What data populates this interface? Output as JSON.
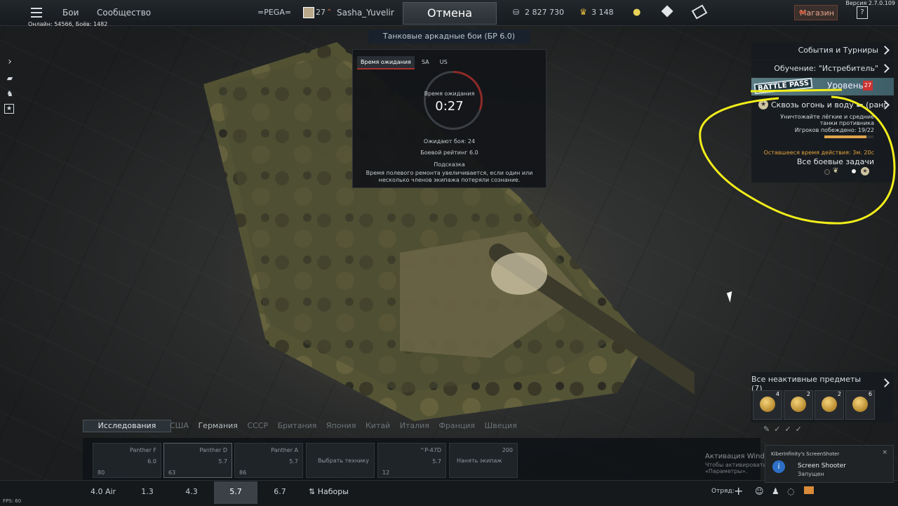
{
  "topbar": {
    "nav": [
      "Бои",
      "Сообщество"
    ],
    "squadron": "=PEGA=",
    "player_level": "27",
    "player_name": "Sasha_Yuvelir",
    "cancel_label": "Отмена",
    "silver_lions": "2 827 730",
    "golden_eagles": "3 148",
    "shop_label": "Магазин",
    "help_label": "?",
    "online_stats": "Онлайн: 54566, Боёв: 1482",
    "version": "Версия 2.7.0.109"
  },
  "game_info": "Танковые аркадные бои (БР 6.0)",
  "queue": {
    "tabs": [
      "Время ожидания",
      "SA",
      "US"
    ],
    "wait_label": "Время ожидания",
    "wait_time": "0:27",
    "waiting_battles": "Ожидают боя: 24",
    "battle_rating": "Боевой рейтинг 6.0",
    "hint_title": "Подсказка",
    "hint_text": "Время полевого ремонта увеличивается, если один или несколько членов экипажа потеряли сознание."
  },
  "right_panel": {
    "events": "События и Турниры",
    "training": "Обучение: \"Истребитель\"",
    "battle_pass_logo": "BATTLE PASS",
    "level_label": "Уровень",
    "level_value": "27",
    "task_title": "Сквозь огонь и воду",
    "task_rank": "(ранг",
    "task_desc": "Уничтожайте лёгкие и средние танки противника",
    "task_progress": "Игроков побеждено: 19/22",
    "task_progress_value": 0.86,
    "time_left": "Оставшееся время действия: 3м. 20с",
    "all_tasks": "Все боевые задачи",
    "inactive_items": "Все неактивные предметы (7)",
    "medals": [
      "4",
      "2",
      "2",
      "6"
    ]
  },
  "bottom": {
    "research_label": "Исследования",
    "nations": [
      "США",
      "Германия",
      "СССР",
      "Британия",
      "Япония",
      "Китай",
      "Италия",
      "Франция",
      "Швеция"
    ],
    "vehicles": [
      {
        "name": "Panther F",
        "br": "6.0",
        "stat": "80"
      },
      {
        "name": "Panther D",
        "br": "5.7",
        "stat": "63"
      },
      {
        "name": "Panther A",
        "br": "5.7",
        "stat": "86"
      }
    ],
    "crew_action": "Выбрать технику",
    "plane_name": "^P-47D",
    "plane_br": "5.7",
    "plane_stat": "12",
    "hire_crew": "Нанять экипаж",
    "hire_cost": "200",
    "br_tabs": [
      "4.0 Air",
      "1.3",
      "4.3",
      "5.7",
      "6.7"
    ],
    "presets": "Наборы",
    "squad_label": "Отряд:",
    "fps": "FPS: 60"
  },
  "os": {
    "activation_title": "Активация Windows",
    "activation_sub": "Чтобы активировать Windows, перейдите в раздел «Параметры».",
    "toast_app": "KiberInfinity's ScreenShoter",
    "toast_title": "Screen Shooter",
    "toast_text": "Запущен"
  },
  "colors": {
    "accent_red": "#a8312e",
    "highlight_yellow": "#f2ee1a",
    "task_gold": "#e0a34c"
  }
}
